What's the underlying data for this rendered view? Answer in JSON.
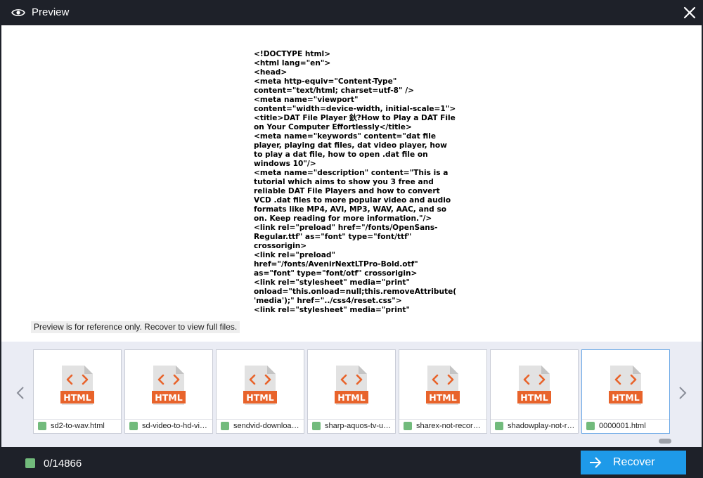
{
  "window": {
    "title": "Preview",
    "title_icon": "eye-icon",
    "close_icon": "close-icon"
  },
  "preview": {
    "code_lines": [
      "<!DOCTYPE html>",
      "<html lang=\"en\">",
      "<head>",
      "<meta http-equiv=\"Content-Type\" content=\"text/html; charset=utf-8\" />",
      "<meta name=\"viewport\" content=\"width=device-width, initial-scale=1\">",
      "<title>DAT File Player 鈥?How to Play a DAT File on Your Computer Effortlessly</title>",
      "<meta name=\"keywords\" content=\"dat file player, playing dat files, dat video player, how to play a dat file, how to open .dat file on windows 10\"/>",
      "<meta name=\"description\" content=\"This is a tutorial which aims to show you 3 free and reliable DAT File Players and how to convert VCD .dat files to more popular video and audio formats like MP4, AVI, MP3, WAV, AAC, and so on. Keep reading for more information.\"/>",
      "<link rel=\"preload\" href=\"/fonts/OpenSans-Regular.ttf\" as=\"font\" type=\"font/ttf\" crossorigin>",
      "<link rel=\"preload\" href=\"/fonts/AvenirNextLTPro-Bold.otf\" as=\"font\" type=\"font/otf\" crossorigin>",
      "<link rel=\"stylesheet\" media=\"print\" onload=\"this.onload=null;this.removeAttribute('media');\" href=\"../css4/reset.css\">",
      "<link rel=\"stylesheet\" media=\"print\""
    ],
    "note": "Preview is for reference only. Recover to view full files."
  },
  "thumbnails": {
    "icon_label": "HTML",
    "items": [
      {
        "name": "sd2-to-wav.html",
        "selected": false
      },
      {
        "name": "sd-video-to-hd-video.html",
        "selected": false
      },
      {
        "name": "sendvid-download.html",
        "selected": false
      },
      {
        "name": "sharp-aquos-tv-usb.html",
        "selected": false
      },
      {
        "name": "sharex-not-recording.html",
        "selected": false
      },
      {
        "name": "shadowplay-not-recording.html",
        "selected": false
      },
      {
        "name": "0000001.html",
        "selected": true
      }
    ]
  },
  "footer": {
    "count": "0/14866",
    "recover_label": "Recover"
  },
  "colors": {
    "background": "#1e2129",
    "accent": "#1e9ae9",
    "checkbox": "#72bb7c",
    "html_icon": "#e8632b"
  }
}
